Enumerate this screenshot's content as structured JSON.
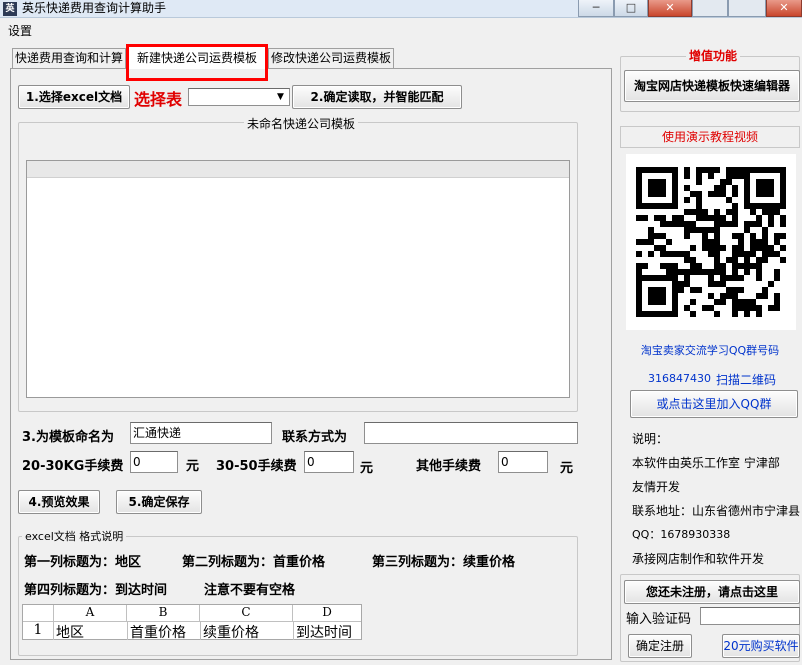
{
  "window": {
    "title": "英乐快递费用查询计算助手",
    "min_label": "─",
    "max_label": "□",
    "close_label": "✕"
  },
  "menu": {
    "settings": "设置"
  },
  "tabs": [
    {
      "label": "快递费用查询和计算"
    },
    {
      "label": "新建快递公司运费模板"
    },
    {
      "label": "修改快递公司运费模板"
    }
  ],
  "toolbar": {
    "select_excel": "1.选择excel文档",
    "select_sheet_label": "选择表",
    "sheet_value": "",
    "confirm_read": "2.确定读取，并智能匹配"
  },
  "template_group": {
    "title": "未命名快递公司模板"
  },
  "form": {
    "name_label": "3.为模板命名为",
    "name_value": "汇通快递",
    "contact_label": "联系方式为",
    "contact_value": "",
    "fee_20_30_label": "20-30KG手续费",
    "fee_20_30_value": "0",
    "fee_30_50_label": "30-50手续费",
    "fee_30_50_value": "0",
    "fee_other_label": "其他手续费",
    "fee_other_value": "0",
    "unit": "元"
  },
  "actions": {
    "preview": "4.预览效果",
    "save": "5.确定保存"
  },
  "format_help": {
    "title": "excel文档 格式说明",
    "line1_col1": "第一列标题为：地区",
    "line1_col2": "第二列标题为：首重价格",
    "line1_col3": "第三列标题为：续重价格",
    "line2_col4": "第四列标题为：到达时间",
    "line2_note": "注意不要有空格",
    "table_headers": [
      "",
      "A",
      "B",
      "C",
      "D"
    ],
    "table_row": [
      "1",
      "地区",
      "首重价格",
      "续重价格",
      "到达时间"
    ]
  },
  "sidebar": {
    "value_added_title": "增值功能",
    "editor_button": "淘宝网店快递模板快速编辑器",
    "tutorial_label": "使用演示教程视频",
    "qq_group_label": "淘宝卖家交流学习QQ群号码",
    "qq_group_number": "316847430",
    "scan_qr": "扫描二维码",
    "join_group_button": "或点击这里加入QQ群",
    "notes_title": "说明：",
    "note_line1": "本软件由英乐工作室 宁津部",
    "note_line2": "友情开发",
    "note_line3": "联系地址：山东省德州市宁津县",
    "note_line4": "QQ：1678930338",
    "note_line5": "承接网店制作和软件开发",
    "register_button": "您还未注册，请点击这里",
    "verify_label": "输入验证码",
    "verify_value": "",
    "confirm_register": "确定注册",
    "buy_button": "20元购买软件"
  },
  "colors": {
    "accent_red": "#e00000",
    "link_blue": "#0033cc",
    "active_tab_outline": "#ff0000"
  }
}
